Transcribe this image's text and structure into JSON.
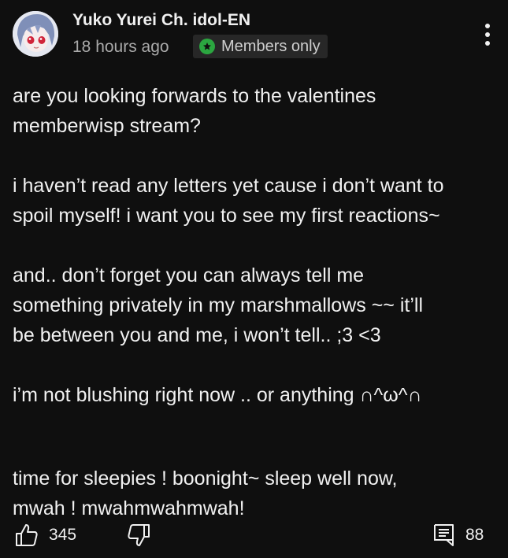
{
  "post": {
    "author": "Yuko Yurei Ch. idol-EN",
    "timestamp": "18 hours ago",
    "badge_label": "Members only",
    "badge_icon": "star-badge-icon",
    "badge_color": "#2ba640",
    "menu_icon": "more-vert-icon",
    "paragraphs": [
      [
        "are you looking forwards to the valentines",
        "memberwisp stream?"
      ],
      [
        "i haven’t read any letters yet cause i don’t want to",
        "spoil myself! i want you to see my first reactions~"
      ],
      [
        "and.. don’t forget you can always tell me",
        "something privately in my marshmallows ~~ it’ll",
        "be between you and me, i won’t tell..  ;3 <3"
      ],
      [
        "i’m not blushing right now .. or anything  ∩^ω^∩"
      ],
      [
        "time for sleepies ! boonight~ sleep well now,",
        "mwah ! mwahmwahmwah!"
      ]
    ],
    "actions": {
      "like_icon": "thumbs-up-icon",
      "like_count": "345",
      "dislike_icon": "thumbs-down-icon",
      "comments_icon": "comment-icon",
      "comment_count": "88"
    }
  }
}
